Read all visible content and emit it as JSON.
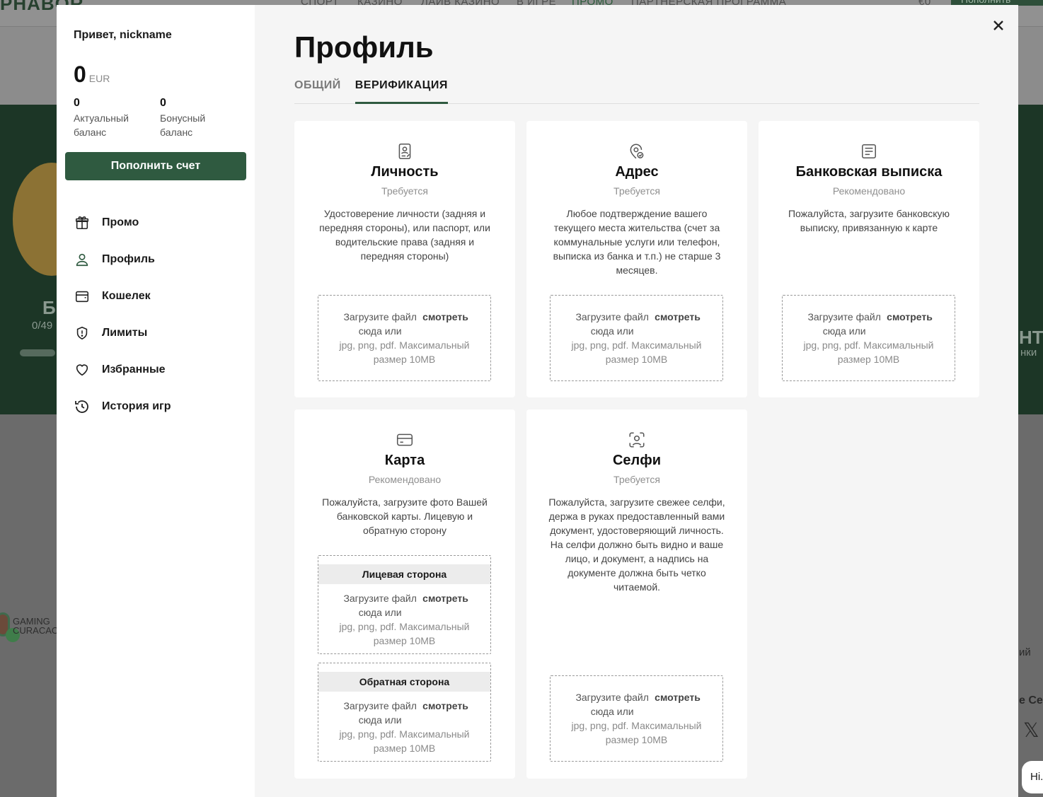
{
  "background": {
    "logo": "PHABOR",
    "nav": [
      "СПОРТ",
      "КАЗИНО",
      "ЛАЙВ КАЗИНО",
      "В ИГРЕ",
      "ПРОМО",
      "ПАРТНЕРСКАЯ ПРОГРАММА"
    ],
    "balance": "€0",
    "deposit_button": "Пополнить счет",
    "hero_letter": "Б",
    "hero_progress": "0/49",
    "hero_right_big": "НТ",
    "hero_right_small": "нки",
    "gaming_line1": "GAMING",
    "gaming_line2": "CURACAO",
    "right_text_1": "ий",
    "right_text_2": "е Се",
    "chat_greeting": "Hi."
  },
  "sidebar": {
    "greeting": "Привет, nickname",
    "balance_amount": "0",
    "balance_currency": "EUR",
    "actual_value": "0",
    "actual_label": "Актуальный баланс",
    "bonus_value": "0",
    "bonus_label": "Бонусный баланс",
    "deposit_label": "Пополнить счет",
    "menu": [
      {
        "label": "Промо",
        "icon": "gift-icon"
      },
      {
        "label": "Профиль",
        "icon": "user-icon"
      },
      {
        "label": "Кошелек",
        "icon": "wallet-icon"
      },
      {
        "label": "Лимиты",
        "icon": "shield-icon"
      },
      {
        "label": "Избранные",
        "icon": "heart-icon"
      },
      {
        "label": "История игр",
        "icon": "history-icon"
      }
    ]
  },
  "main": {
    "title": "Профиль",
    "tabs": [
      "ОБЩИЙ",
      "ВЕРИФИКАЦИЯ"
    ],
    "active_tab": "ВЕРИФИКАЦИЯ",
    "close_icon": "close-icon"
  },
  "upload_text": {
    "drop": "Загрузите файл сюда или",
    "browse": "смотреть",
    "hint": "jpg, png, pdf. Максимальный размер 10MB"
  },
  "cards": [
    {
      "title": "Личность",
      "status": "Требуется",
      "icon": "id-document-icon",
      "description": "Удостоверение личности (задняя и передняя стороны), или паспорт, или водительские права (задняя и передняя стороны)"
    },
    {
      "title": "Адрес",
      "status": "Требуется",
      "icon": "location-pin-icon",
      "description": "Любое подтверждение вашего текущего места жительства (счет за коммунальные услуги или телефон, выписка из банка и т.п.) не старше 3 месяцев."
    },
    {
      "title": "Банковская выписка",
      "status": "Рекомендовано",
      "icon": "statement-icon",
      "description": "Пожалуйста, загрузите банковскую выписку, привязанную к карте"
    },
    {
      "title": "Карта",
      "status": "Рекомендовано",
      "icon": "card-icon",
      "description": "Пожалуйста, загрузите фото Вашей банковской карты. Лицевую и обратную сторону",
      "sides": [
        "Лицевая сторона",
        "Обратная сторона"
      ]
    },
    {
      "title": "Селфи",
      "status": "Требуется",
      "icon": "face-scan-icon",
      "description": "Пожалуйста, загрузите свежее селфи, держа в руках предоставленный вами документ, удостоверяющий личность. На селфи должно быть видно и ваше лицо, и документ, а надпись на документе должна быть четко читаемой."
    }
  ],
  "colors": {
    "accent": "#2f5a40",
    "overlay": "#6b6b6b",
    "card_bg": "#ffffff",
    "modal_bg": "#f5f5f5"
  }
}
